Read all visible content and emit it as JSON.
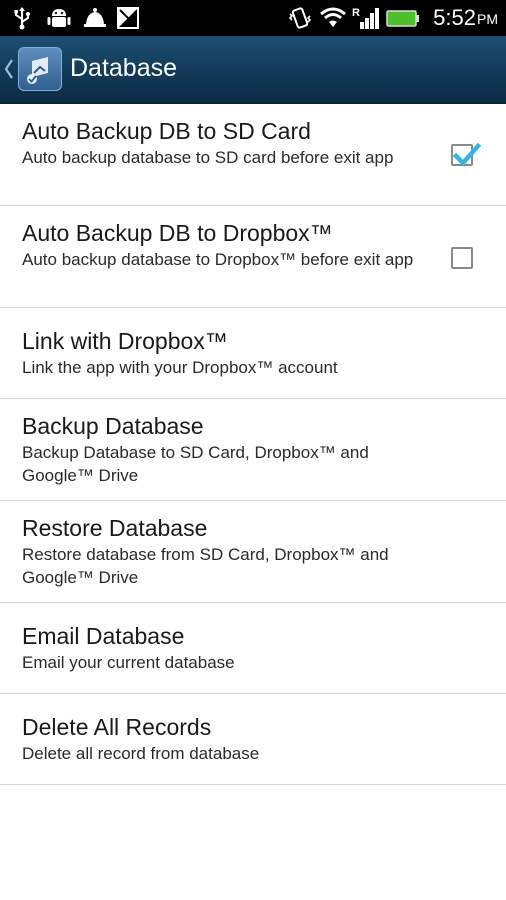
{
  "status_bar": {
    "time": "5:52",
    "ampm": "PM",
    "icons": [
      "usb-icon",
      "android-debug-icon",
      "bell-icon",
      "signal-blocked-icon",
      "vibrate-icon",
      "wifi-icon",
      "cell-signal-icon",
      "battery-icon"
    ],
    "battery_color": "#4cc12b"
  },
  "action_bar": {
    "title": "Database",
    "background_color": "#123a58"
  },
  "settings": [
    {
      "title": "Auto Backup DB to SD Card",
      "summary": "Auto backup database to SD card before exit app",
      "checkbox": true,
      "checked": true
    },
    {
      "title": "Auto Backup DB to Dropbox™",
      "summary": "Auto backup database to Dropbox™ before exit app",
      "checkbox": true,
      "checked": false
    },
    {
      "title": "Link with Dropbox™",
      "summary": "Link the app with your Dropbox™ account",
      "checkbox": false
    },
    {
      "title": "Backup Database",
      "summary": "Backup Database to SD Card, Dropbox™ and Google™ Drive",
      "checkbox": false
    },
    {
      "title": "Restore Database",
      "summary": "Restore database from SD Card, Dropbox™ and Google™ Drive",
      "checkbox": false
    },
    {
      "title": "Email Database",
      "summary": "Email your current database",
      "checkbox": false
    },
    {
      "title": "Delete All Records",
      "summary": "Delete all record from database",
      "checkbox": false
    }
  ],
  "colors": {
    "checkmark": "#33b5e5",
    "divider": "#d6d6d6"
  }
}
